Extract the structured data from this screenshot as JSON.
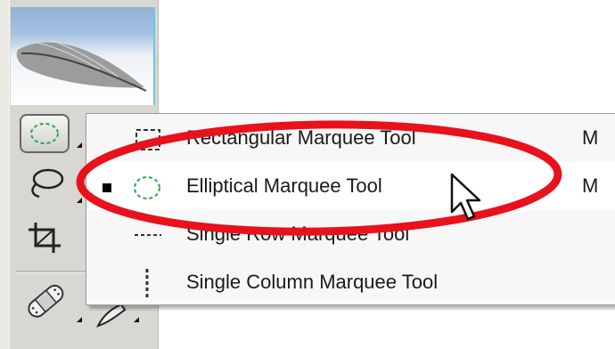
{
  "flyout_menu": {
    "items": [
      {
        "label": "Rectangular Marquee Tool",
        "shortcut": "M",
        "icon": "rectangular-marquee-icon",
        "selected": false
      },
      {
        "label": "Elliptical Marquee Tool",
        "shortcut": "M",
        "icon": "elliptical-marquee-icon",
        "selected": true
      },
      {
        "label": "Single Row Marquee Tool",
        "shortcut": "",
        "icon": "single-row-marquee-icon",
        "selected": false
      },
      {
        "label": "Single Column Marquee Tool",
        "shortcut": "",
        "icon": "single-column-marquee-icon",
        "selected": false
      }
    ]
  },
  "toolbox": {
    "tools": [
      "elliptical-marquee-icon",
      "lasso-icon",
      "crop-icon",
      "healing-brush-icon",
      "brush-icon"
    ]
  },
  "colors": {
    "highlight_ellipse": "#e8111c",
    "marquee_icon_green": "#2aa84a",
    "menu_background": "#f7f7f7"
  }
}
